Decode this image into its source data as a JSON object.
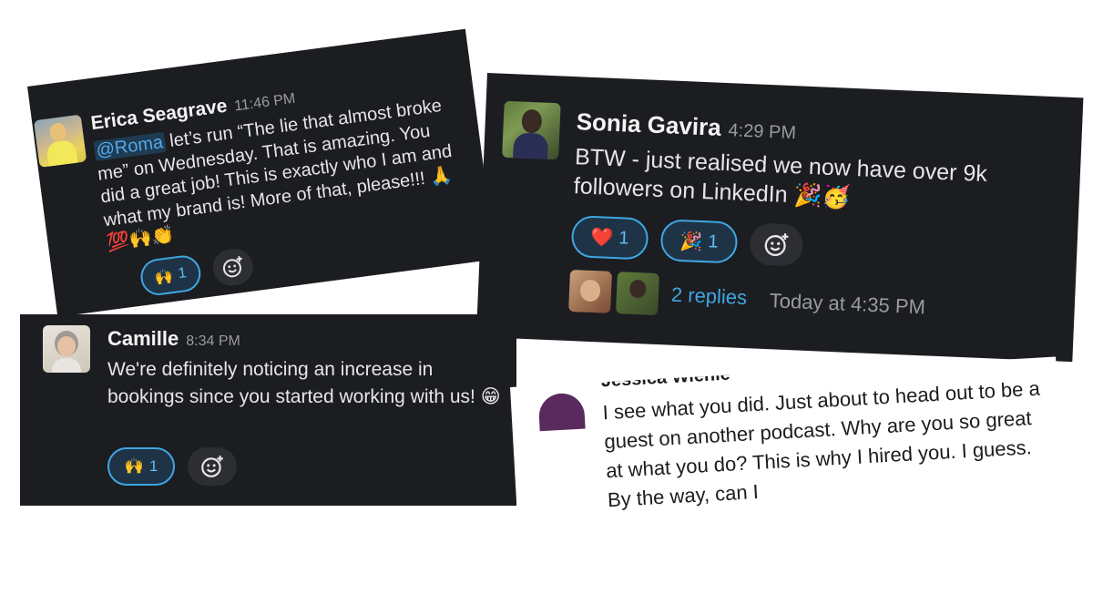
{
  "messages": {
    "erica": {
      "author": "Erica Seagrave",
      "time": "11:46 PM",
      "mention": "@Roma",
      "text_after_mention": " let’s run “The lie that almost broke me” on Wednesday. That is amazing. You did a great job! This is exactly who I am and what my brand is! More of that, please!!! 🙏💯🙌👏",
      "reaction": {
        "emoji": "🙌",
        "count": "1"
      }
    },
    "sonia": {
      "author": "Sonia Gavira",
      "time": "4:29 PM",
      "text": "BTW - just realised we now have over 9k followers on LinkedIn 🎉🥳",
      "reactions": [
        {
          "emoji": "❤️",
          "count": "1"
        },
        {
          "emoji": "🎉",
          "count": "1"
        }
      ],
      "replies_label": "2 replies",
      "replies_time": "Today at 4:35 PM"
    },
    "camille": {
      "author": "Camille",
      "time": "8:34 PM",
      "text": "We're definitely noticing an increase in bookings since you started working with us! 😁",
      "reaction": {
        "emoji": "🙌",
        "count": "1"
      }
    },
    "jessica": {
      "author_partial": "Jessica Wiehle",
      "text": "I see what you did. Just about to head out to be a guest on another podcast. Why are you so great at what you do? This is why I hired you. I guess. By the way, can I"
    }
  }
}
